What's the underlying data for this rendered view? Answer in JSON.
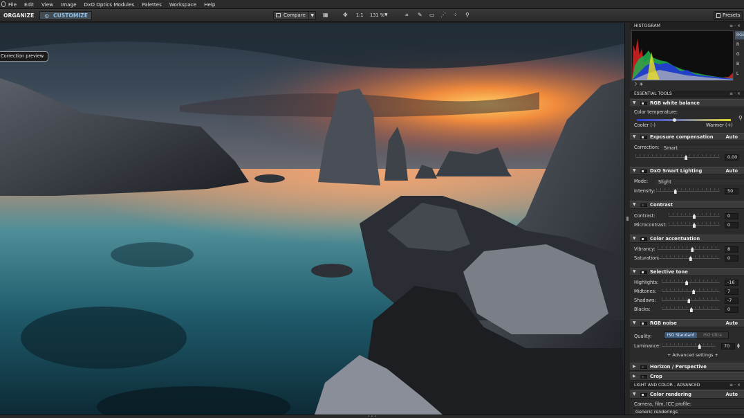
{
  "menu": [
    "File",
    "Edit",
    "View",
    "Image",
    "DxO Optics Modules",
    "Palettes",
    "Workspace",
    "Help"
  ],
  "toolbar": {
    "organize_label": "ORGANIZE",
    "customize_label": "CUSTOMIZE",
    "compare_label": "Compare",
    "zoom_fit_label": "1:1",
    "zoom_level": "131 %",
    "presets_label": "Presets"
  },
  "preview": {
    "correction_preview_label": "Correction preview"
  },
  "histogram": {
    "title": "HISTOGRAM",
    "channels": [
      "RGB",
      "R",
      "G",
      "B",
      "L"
    ],
    "selected_channel": "RGB"
  },
  "essential_tools": {
    "title": "ESSENTIAL TOOLS",
    "white_balance": {
      "title": "RGB white balance",
      "temp_label": "Color temperature:",
      "cooler": "Cooler (-)",
      "warmer": "Warmer (+)",
      "value": 0.5
    },
    "exposure": {
      "title": "Exposure compensation",
      "auto": "Auto",
      "correction_label": "Correction:",
      "correction_value": "Smart",
      "value": "0.00"
    },
    "smart_lighting": {
      "title": "DxO Smart Lighting",
      "auto": "Auto",
      "mode_label": "Mode:",
      "mode_value": "Slight",
      "intensity_label": "Intensity:",
      "intensity_value": "50"
    },
    "contrast": {
      "title": "Contrast",
      "contrast_label": "Contrast:",
      "contrast_value": "0",
      "micro_label": "Microcontrast:",
      "micro_value": "0"
    },
    "color_accent": {
      "title": "Color accentuation",
      "vibrancy_label": "Vibrancy:",
      "vibrancy_value": "8",
      "saturation_label": "Saturation:",
      "saturation_value": "0"
    },
    "selective_tone": {
      "title": "Selective tone",
      "highlights_label": "Highlights:",
      "highlights_value": "-16",
      "midtones_label": "Midtones:",
      "midtones_value": "7",
      "shadows_label": "Shadows:",
      "shadows_value": "-7",
      "blacks_label": "Blacks:",
      "blacks_value": "0"
    },
    "noise": {
      "title": "RGB noise",
      "auto": "Auto",
      "quality_label": "Quality:",
      "quality_standard": "ISO Standard",
      "quality_ultra": "ISO Ultra",
      "luminance_label": "Luminance:",
      "luminance_value": "70",
      "advanced": "+ Advanced settings +"
    },
    "horizon": {
      "title": "Horizon / Perspective"
    },
    "crop": {
      "title": "Crop"
    }
  },
  "light_color_advanced": {
    "title": "LIGHT AND COLOR - ADVANCED",
    "color_rendering": {
      "title": "Color rendering",
      "auto": "Auto",
      "profile_label": "Camera, film, ICC profile:",
      "profile_value": "Generic renderings"
    }
  }
}
